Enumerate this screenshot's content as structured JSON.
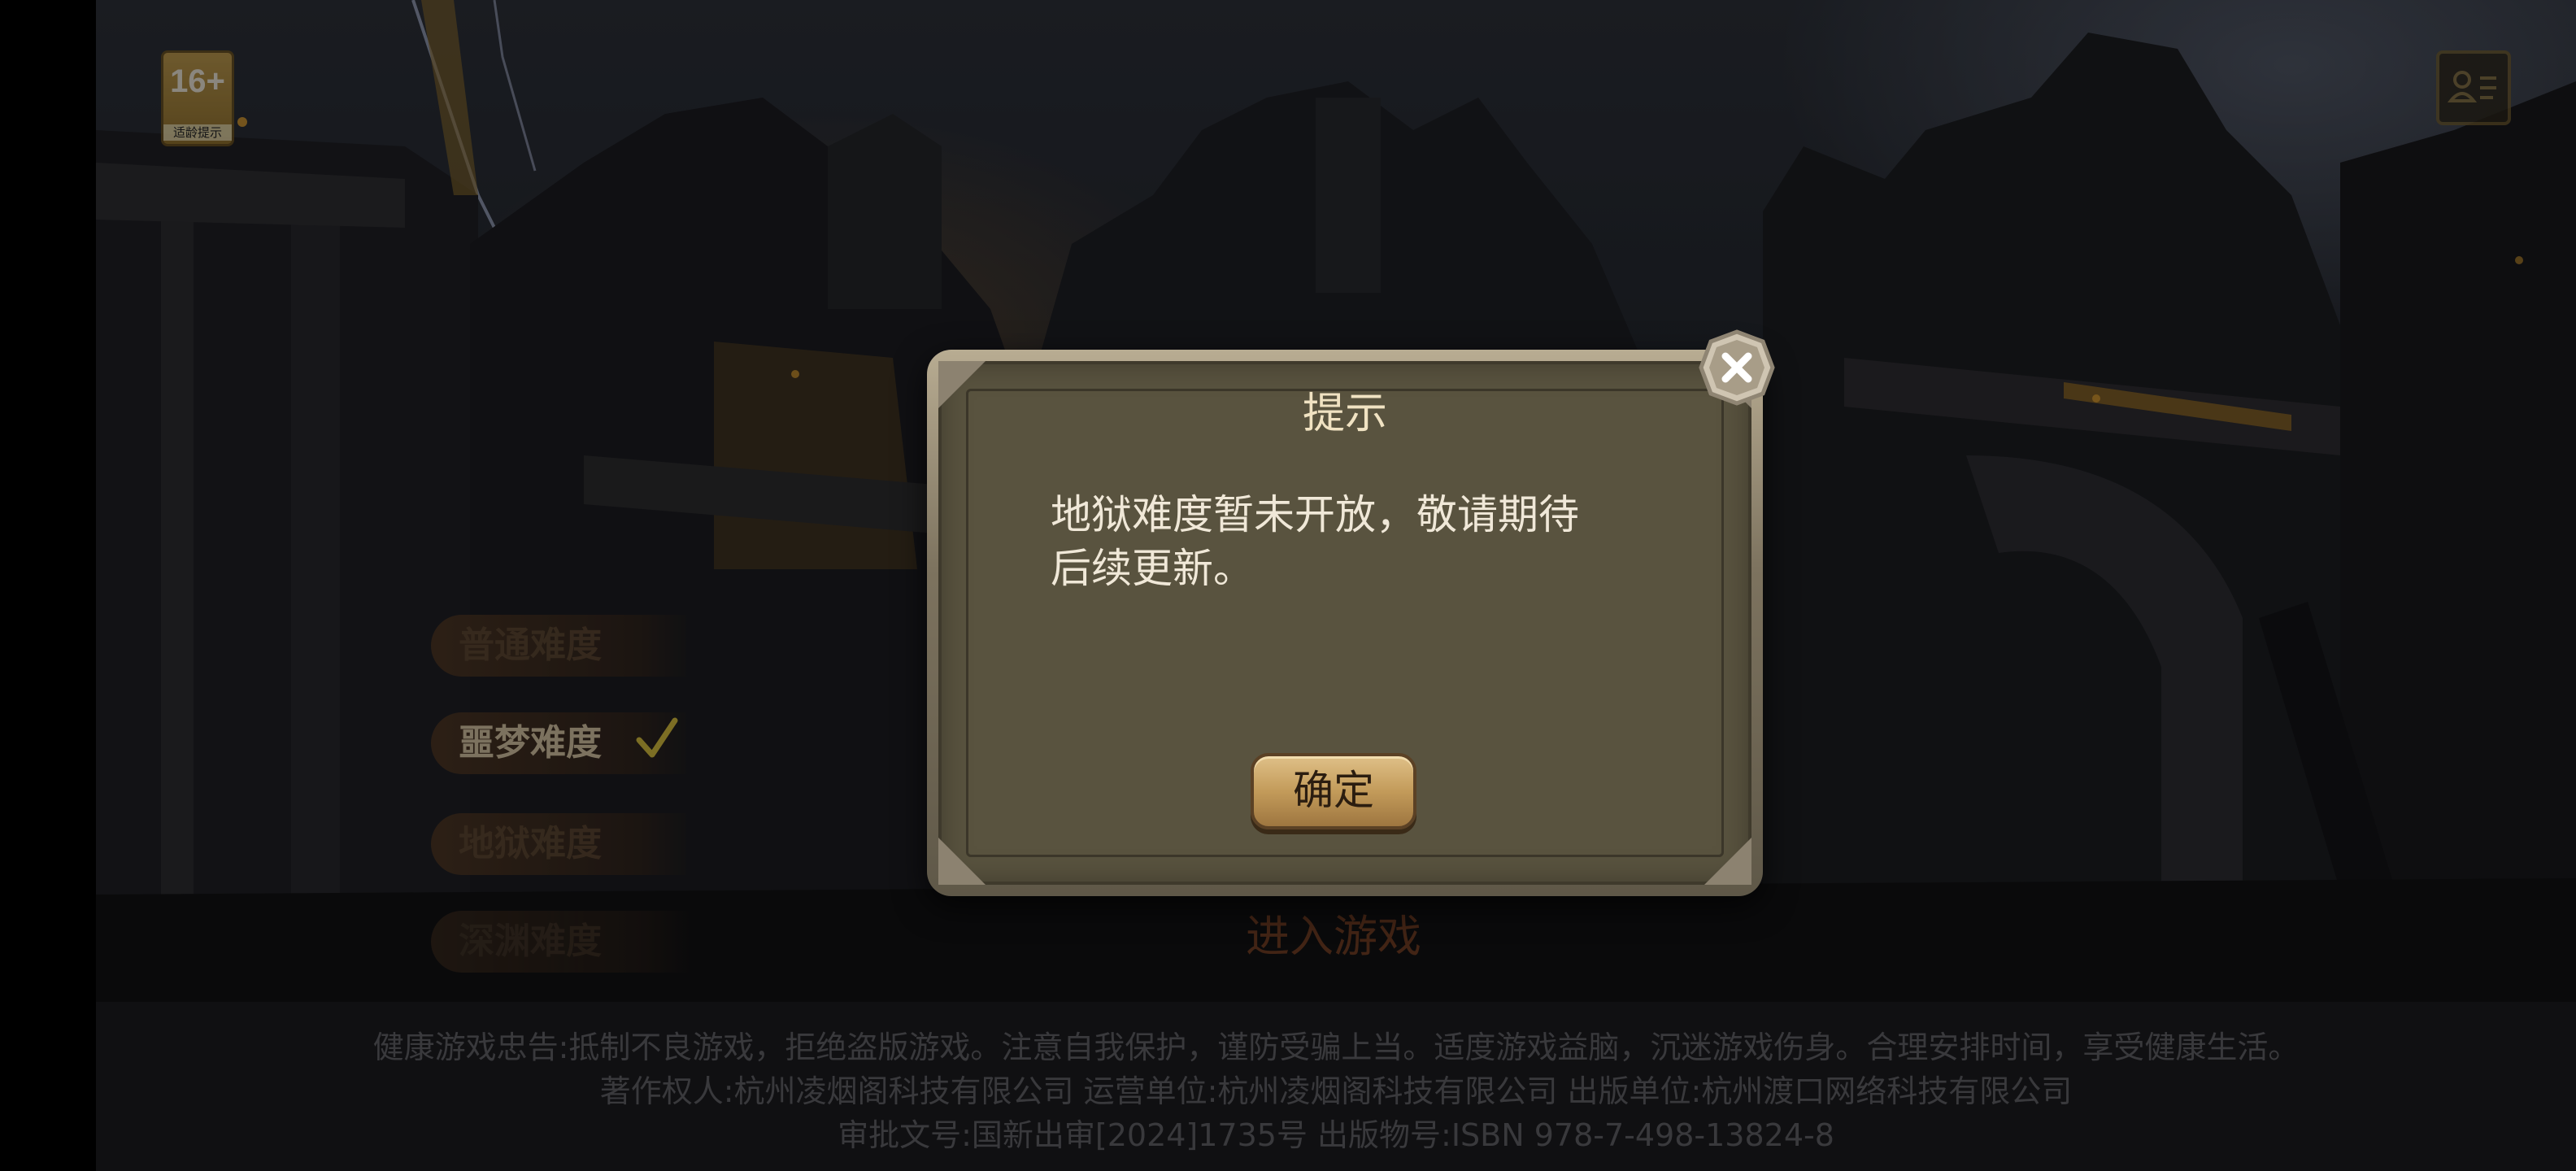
{
  "age_badge": {
    "rating": "16+",
    "label": "适龄提示"
  },
  "difficulty_menu": {
    "items": [
      {
        "label": "普通难度",
        "selected": false
      },
      {
        "label": "噩梦难度",
        "selected": true
      },
      {
        "label": "地狱难度",
        "selected": false
      },
      {
        "label": "深渊难度",
        "selected": false
      }
    ]
  },
  "enter_game": {
    "label": "进入游戏"
  },
  "modal": {
    "title": "提示",
    "message_line1": "地狱难度暂未开放，敬请期待",
    "message_line2": "后续更新。",
    "confirm_label": "确定"
  },
  "footer": {
    "health_notice": "健康游戏忠告:抵制不良游戏，拒绝盗版游戏。注意自我保护，谨防受骗上当。适度游戏益脑，沉迷游戏伤身。合理安排时间，享受健康生活。",
    "copyright": "著作权人:杭州凌烟阁科技有限公司 运营单位:杭州凌烟阁科技有限公司 出版单位:杭州渡口网络科技有限公司",
    "approval": "审批文号:国新出审[2024]1735号 出版物号:ISBN 978-7-498-13824-8"
  },
  "colors": {
    "accent_gold": "#c39b5a",
    "panel": "#59533f",
    "check": "#c9b23a"
  }
}
